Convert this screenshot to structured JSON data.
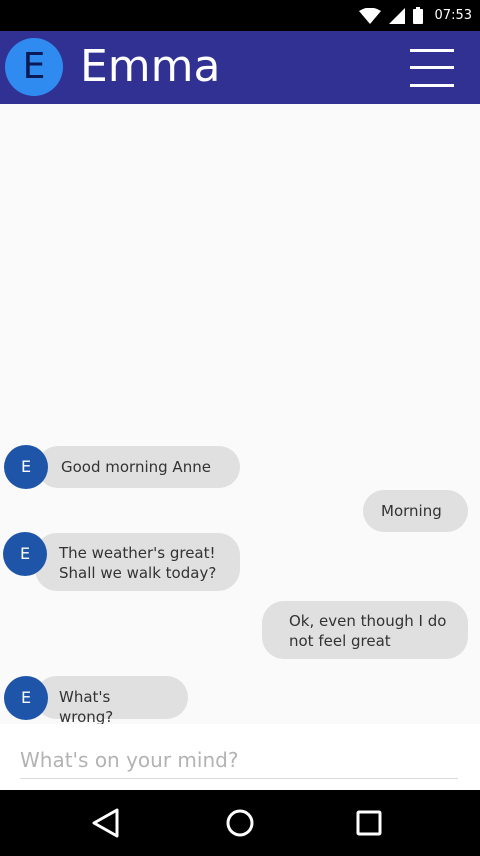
{
  "status_bar": {
    "time": "07:53",
    "icons": [
      "wifi-icon",
      "cell-signal-icon",
      "battery-icon"
    ]
  },
  "app_bar": {
    "avatar_initial": "E",
    "title": "Emma",
    "menu_icon": "hamburger-menu-icon",
    "colors": {
      "background": "#303193",
      "avatar": "#2f8bf0"
    }
  },
  "messages": [
    {
      "from": "Emma",
      "avatar_initial": "E",
      "text": "Good morning Anne",
      "side": "left"
    },
    {
      "from": "Anne",
      "text": "Morning",
      "side": "right"
    },
    {
      "from": "Emma",
      "avatar_initial": "E",
      "text_lines": [
        "The weather's great!",
        "Shall we walk today?"
      ],
      "side": "left"
    },
    {
      "from": "Anne",
      "text_lines": [
        "Ok, even though I do",
        "not feel great"
      ],
      "side": "right"
    },
    {
      "from": "Emma",
      "avatar_initial": "E",
      "text": "What's wrong?",
      "side": "left"
    }
  ],
  "composer": {
    "placeholder": "What's on your mind?",
    "value": ""
  },
  "nav_bar": {
    "buttons": [
      "back-icon",
      "home-icon",
      "recents-icon"
    ]
  }
}
